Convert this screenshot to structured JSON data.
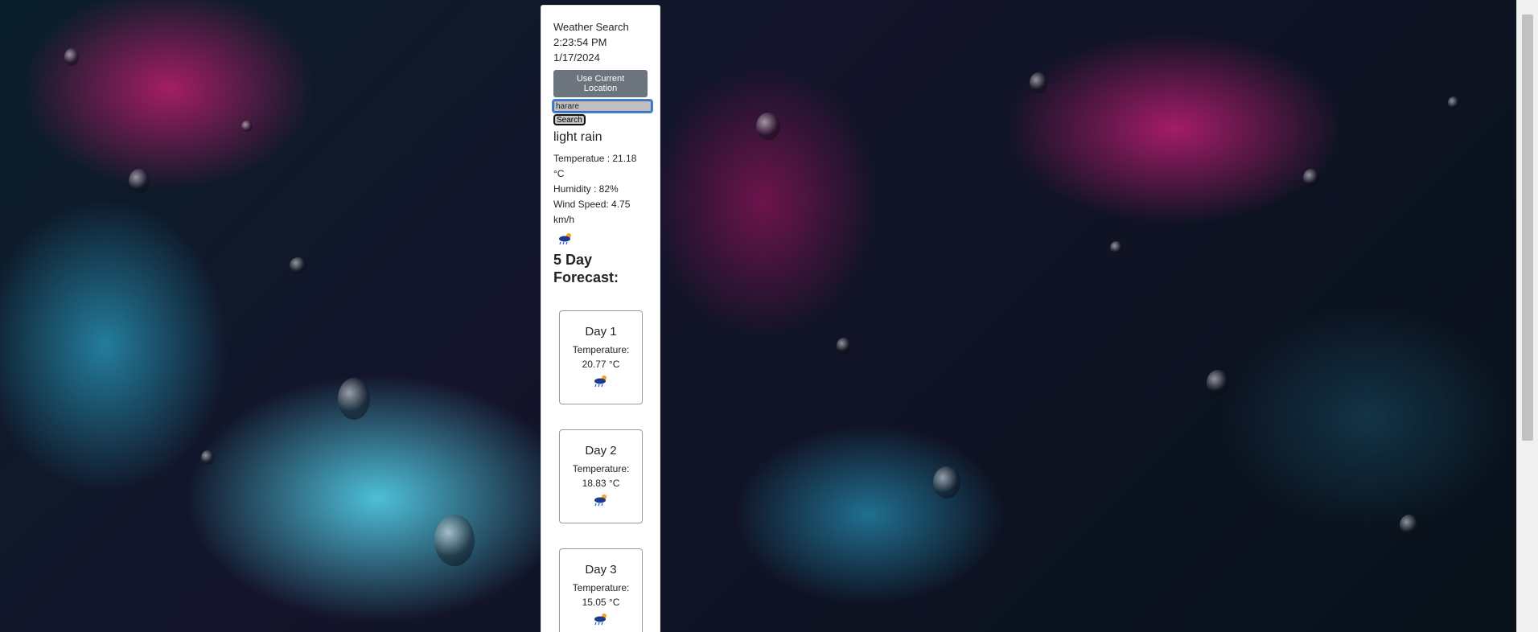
{
  "header": {
    "title": "Weather Search",
    "time": "2:23:54 PM",
    "date": "1/17/2024"
  },
  "controls": {
    "location_button": "Use Current Location",
    "search_value": "harare",
    "search_button": "Search"
  },
  "current": {
    "condition": "light rain",
    "temperature": "Temperatue : 21.18 °C",
    "humidity": "Humidity : 82%",
    "wind": "Wind Speed: 4.75 km/h",
    "icon": "rain-cloud-icon"
  },
  "forecast": {
    "title": "5 Day Forecast:",
    "days": [
      {
        "label": "Day 1",
        "temp_label": "Temperature:",
        "temp": "20.77 °C",
        "icon": "rain-cloud-icon"
      },
      {
        "label": "Day 2",
        "temp_label": "Temperature:",
        "temp": "18.83 °C",
        "icon": "rain-cloud-icon"
      },
      {
        "label": "Day 3",
        "temp_label": "Temperature:",
        "temp": "15.05 °C",
        "icon": "rain-cloud-icon"
      }
    ]
  },
  "colors": {
    "panel_bg": "#ffffff",
    "button_gray": "#6c757d",
    "input_focus": "#4a7fc9"
  }
}
